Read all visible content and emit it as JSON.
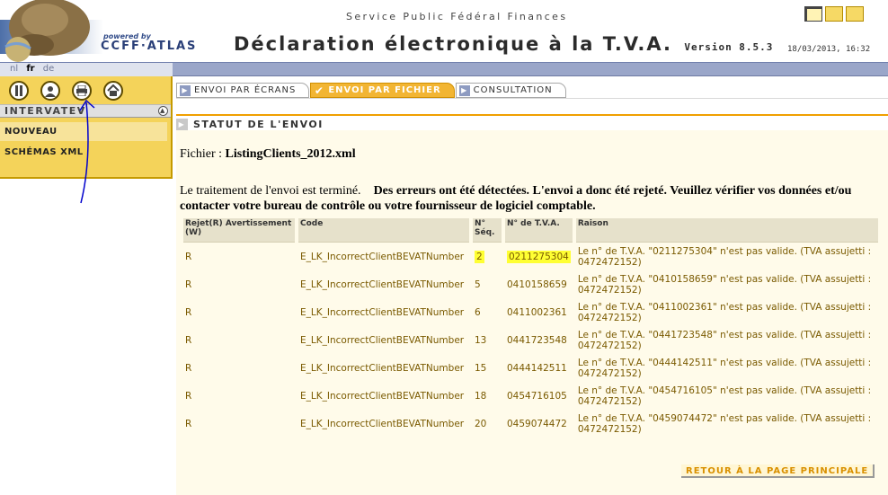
{
  "header": {
    "powered_by": "powered by",
    "brand": "CCFF·ATLAS",
    "service": "Service Public Fédéral Finances",
    "title": "Déclaration électronique à la T.V.A.",
    "version": "Version 8.5.3",
    "datetime": "18/03/2013, 16:32"
  },
  "languages": {
    "nl": "nl",
    "fr": "fr",
    "de": "de"
  },
  "sidebar": {
    "title": "INTERVATEV",
    "items": [
      {
        "label": "NOUVEAU"
      },
      {
        "label": "SCHÉMAS XML"
      }
    ]
  },
  "tabs": [
    {
      "label": "ENVOI PAR ÉCRANS"
    },
    {
      "label": "ENVOI PAR FICHIER"
    },
    {
      "label": "CONSULTATION"
    }
  ],
  "status": {
    "heading": "STATUT DE L'ENVOI",
    "file_label": "Fichier :",
    "file_name": "ListingClients_2012.xml",
    "message_plain": "Le traitement de l'envoi est terminé.",
    "message_bold": "Des erreurs ont été détectées. L'envoi a donc été rejeté. Veuillez vérifier vos données et/ou contacter votre bureau de contrôle ou votre fournisseur de logiciel comptable."
  },
  "table": {
    "headers": {
      "type": "Rejet(R) Avertissement (W)",
      "code": "Code",
      "seq": "N° Séq.",
      "vat": "N° de T.V.A.",
      "reason": "Raison"
    },
    "rows": [
      {
        "type": "R",
        "code": "E_LK_IncorrectClientBEVATNumber",
        "seq": "2",
        "vat": "0211275304",
        "reason": "Le n° de T.V.A. \"0211275304\" n'est pas valide. (TVA assujetti : 0472472152)"
      },
      {
        "type": "R",
        "code": "E_LK_IncorrectClientBEVATNumber",
        "seq": "5",
        "vat": "0410158659",
        "reason": "Le n° de T.V.A. \"0410158659\" n'est pas valide. (TVA assujetti : 0472472152)"
      },
      {
        "type": "R",
        "code": "E_LK_IncorrectClientBEVATNumber",
        "seq": "6",
        "vat": "0411002361",
        "reason": "Le n° de T.V.A. \"0411002361\" n'est pas valide. (TVA assujetti : 0472472152)"
      },
      {
        "type": "R",
        "code": "E_LK_IncorrectClientBEVATNumber",
        "seq": "13",
        "vat": "0441723548",
        "reason": "Le n° de T.V.A. \"0441723548\" n'est pas valide. (TVA assujetti : 0472472152)"
      },
      {
        "type": "R",
        "code": "E_LK_IncorrectClientBEVATNumber",
        "seq": "15",
        "vat": "0444142511",
        "reason": "Le n° de T.V.A. \"0444142511\" n'est pas valide. (TVA assujetti : 0472472152)"
      },
      {
        "type": "R",
        "code": "E_LK_IncorrectClientBEVATNumber",
        "seq": "18",
        "vat": "0454716105",
        "reason": "Le n° de T.V.A. \"0454716105\" n'est pas valide. (TVA assujetti : 0472472152)"
      },
      {
        "type": "R",
        "code": "E_LK_IncorrectClientBEVATNumber",
        "seq": "20",
        "vat": "0459074472",
        "reason": "Le n° de T.V.A. \"0459074472\" n'est pas valide. (TVA assujetti : 0472472152)"
      }
    ]
  },
  "actions": {
    "return_label": "RETOUR À LA PAGE PRINCIPALE"
  },
  "icons": [
    "help-icon",
    "user-icon",
    "print-icon",
    "home-icon"
  ],
  "colors": {
    "accent": "#f2b533",
    "panel": "#f4d35a",
    "nav_bar": "#9aa6c9",
    "cell_text": "#7a5a00",
    "highlight": "#ffff33"
  }
}
